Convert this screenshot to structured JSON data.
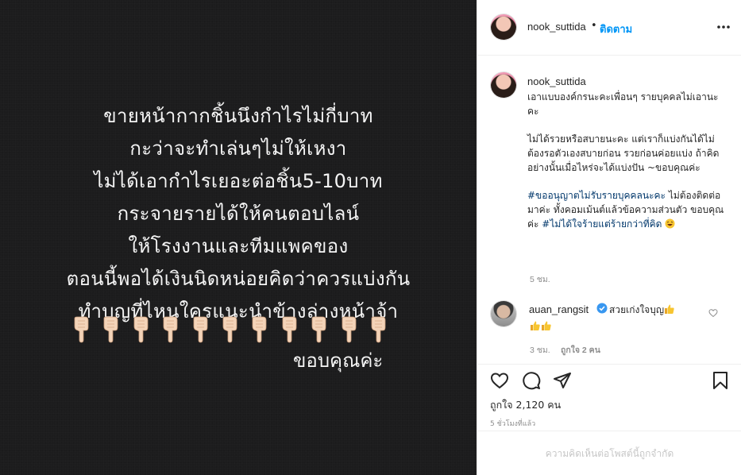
{
  "post": {
    "text_lines": [
      "ขายหน้ากากชิ้นนึงกำไรไม่กี่บาท",
      "กะว่าจะทำเล่นๆไม่ให้เหงา",
      "ไม่ได้เอากำไรเยอะต่อชิ้น5-10บาท",
      "กระจายรายได้ให้คนตอบไลน์",
      "ให้โรงงานและทีมแพคของ",
      "ตอนนี้พอได้เงินนิดหน่อยคิดว่าควรแบ่งกัน",
      "ทำบุญที่ไหนใครแนะนำข้างล่างหน้าจ้า"
    ],
    "pointing_down_count": 11,
    "closing_text": "ขอบคุณค่ะ"
  },
  "header": {
    "username": "nook_suttida",
    "separator": "•",
    "follow_label": "ติดตาม"
  },
  "caption": {
    "username": "nook_suttida",
    "para1": "เอาแบบองค์กรนะคะเพื่อนๆ รายบุคคลไม่เอานะคะ",
    "para2": "ไม่ได้รวยหรือสบายนะคะ แต่เราก็แบ่งกันได้ไม่ต้องรอตัวเองสบายก่อน รวยก่อนค่อยแบ่ง ถ้าคิดอย่างนั้นเมื่อไหร่จะได้แบ่งปัน ~ขอบคุณค่ะ",
    "hashtag1": "#ขออนุญาตไม่รับรายบุคคลนะคะ",
    "para3_mid": " ไม่ต้องติดต่อมาค่ะ ทั้งคอมเม้นต์แล้วข้อความส่วนตัว ขอบคุณค่ะ ",
    "hashtag2": "#ไม่ได้ใจร้ายแต่ร้ายกว่าที่คิด",
    "time": "5 ชม."
  },
  "comment": {
    "username": "auan_rangsit",
    "text": "สวยเก่งใจบุญ",
    "time": "3 ชม.",
    "likes": "ถูกใจ 2 คน"
  },
  "actions": {
    "likes_text": "ถูกใจ 2,120 คน",
    "posted_ago": "5 ชั่วโมงที่แล้ว"
  },
  "comments_disabled_text": "ความคิดเห็นต่อโพสต์นี้ถูกจำกัด",
  "colors": {
    "post_background": "#1c1c1d",
    "link_blue": "#0095f6",
    "hashtag": "#00376b",
    "muted": "#8e8e8e"
  },
  "icons": [
    "more-options-icon",
    "verified-badge-icon",
    "heart-icon",
    "comment-icon",
    "share-icon",
    "bookmark-icon",
    "pointing-down-emoji",
    "thumbs-up-emoji",
    "laughing-emoji"
  ]
}
